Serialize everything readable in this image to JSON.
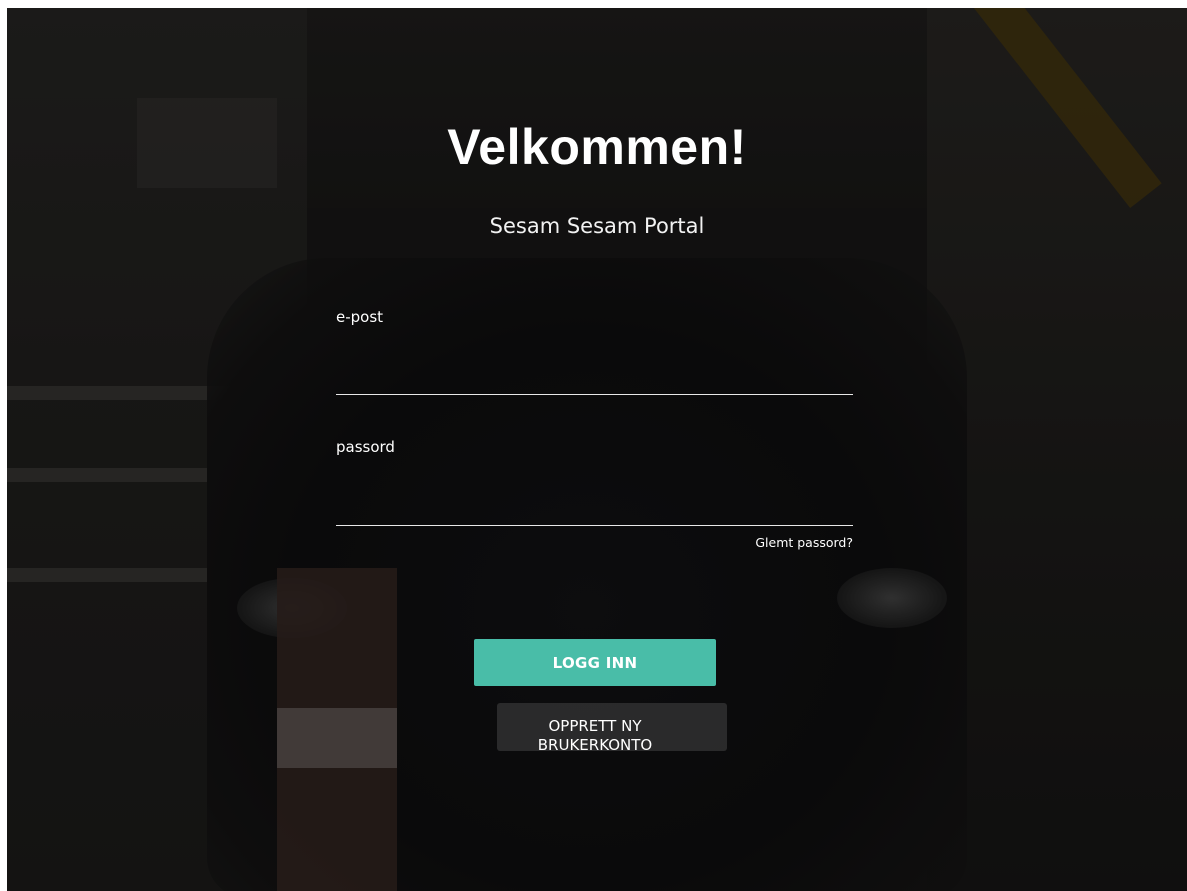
{
  "login": {
    "title": "Velkommen!",
    "subtitle": "Sesam Sesam Portal",
    "email_label": "e-post",
    "email_value": "",
    "password_label": "passord",
    "password_value": "",
    "forgot_link": "Glemt passord?",
    "login_button": "LOGG INN",
    "create_account_line1": "OPPRETT NY",
    "create_account_line2": "BRUKERKONTO",
    "accent_color": "#49bda8"
  }
}
